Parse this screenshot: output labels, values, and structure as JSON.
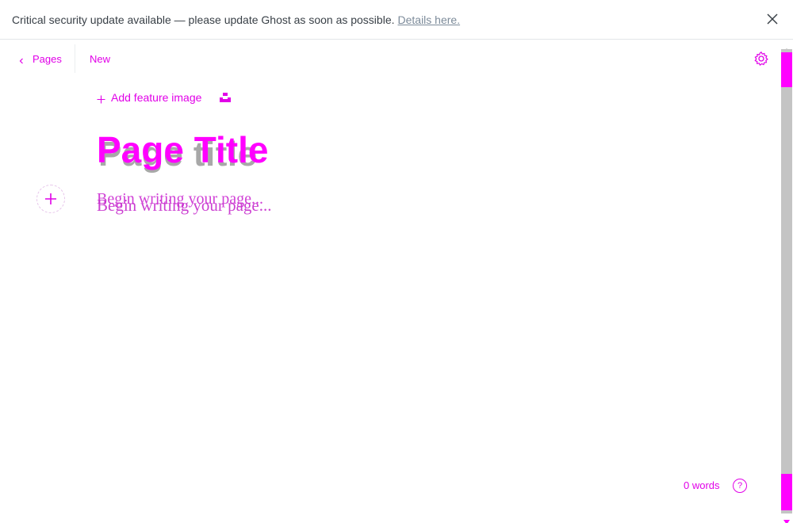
{
  "banner": {
    "message": "Critical security update available — please update Ghost as soon as possible.",
    "link_text": "Details here.",
    "close_icon": "close-icon"
  },
  "header": {
    "back_label": "Pages",
    "status": "New",
    "settings_icon": "gear-icon"
  },
  "feature_image": {
    "add_label": "Add feature image",
    "unsplash_icon": "unsplash-icon"
  },
  "editor": {
    "title_placeholder": "Page Title",
    "title_ghost": "Page title",
    "body_placeholder": "Begin writing your page...",
    "body_ghost": "Begin writing your page..."
  },
  "footer": {
    "word_count": "0 words",
    "help_label": "?"
  },
  "colors": {
    "accent": "#ff00ff",
    "link": "#e100e8",
    "placeholder_gray": "#a8a8a8",
    "scrollbar_track": "#c4c4c4"
  }
}
